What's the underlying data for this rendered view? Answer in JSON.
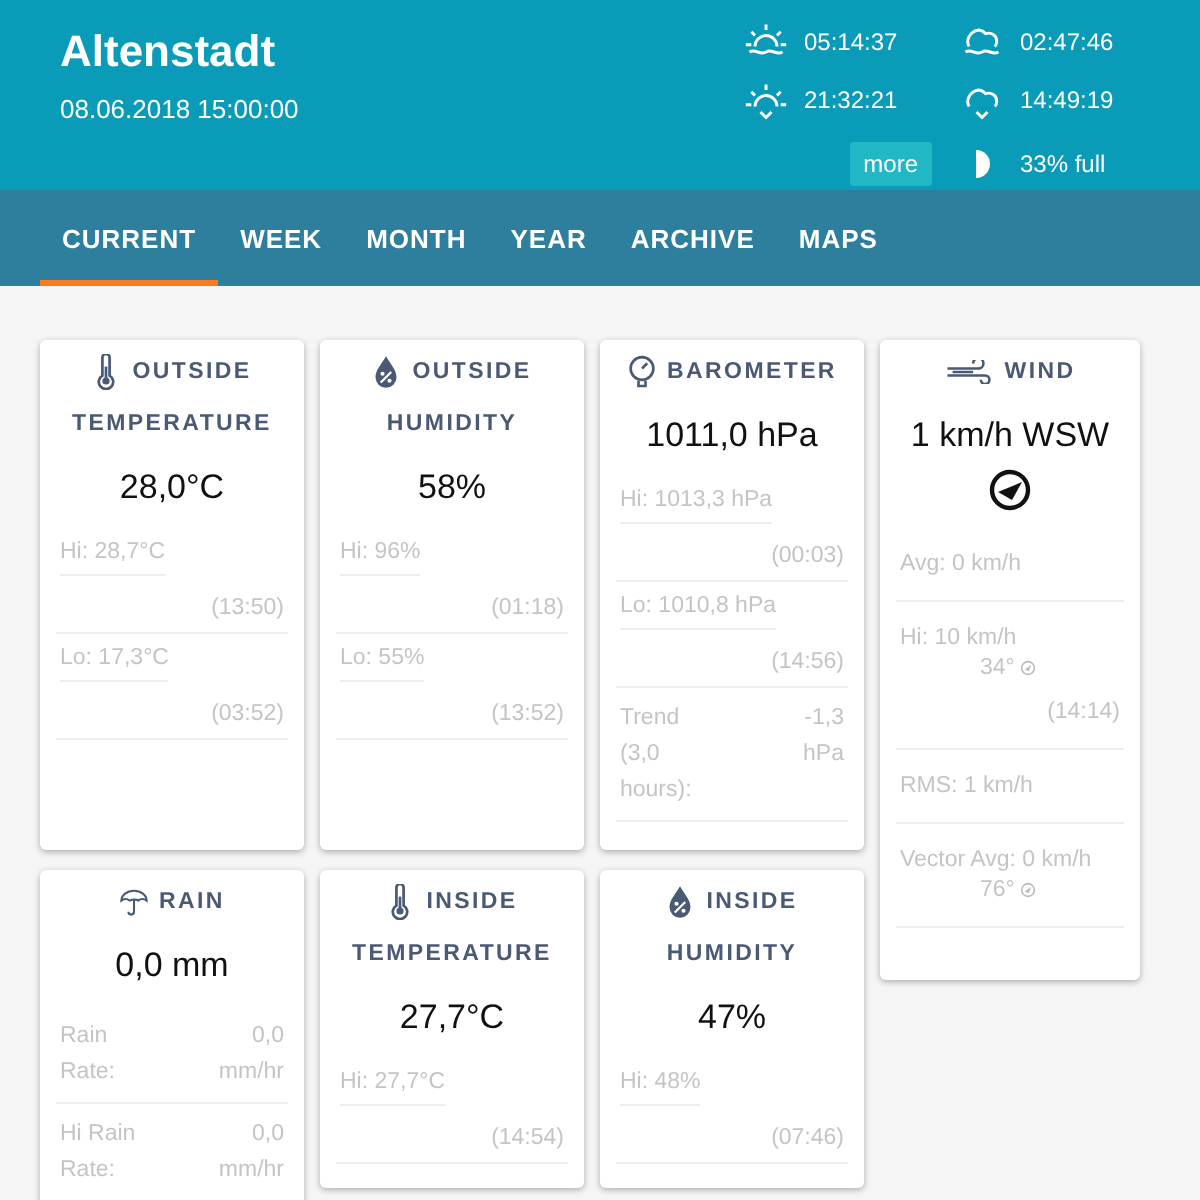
{
  "header": {
    "station": "Altenstadt",
    "datetime": "08.06.2018 15:00:00",
    "almanac": [
      {
        "kind": "sunrise",
        "time": "05:14:37"
      },
      {
        "kind": "moonrise",
        "time": "02:47:46"
      },
      {
        "kind": "sunset",
        "time": "21:32:21"
      },
      {
        "kind": "moonset",
        "time": "14:49:19"
      }
    ],
    "more_button": "more",
    "moon_phase": "33% full"
  },
  "tabs": [
    {
      "label": "CURRENT",
      "selected": true
    },
    {
      "label": "WEEK",
      "selected": false
    },
    {
      "label": "MONTH",
      "selected": false
    },
    {
      "label": "YEAR",
      "selected": false
    },
    {
      "label": "ARCHIVE",
      "selected": false
    },
    {
      "label": "MAPS",
      "selected": false
    }
  ],
  "cards": [
    {
      "kind": "thermometer",
      "title": [
        "OUTSIDE",
        "TEMPERATURE"
      ],
      "value": "28,0°C",
      "stats": [
        {
          "kind": "hilo",
          "text": "Hi: 28,7°C",
          "time": "(13:50)"
        },
        {
          "kind": "hilo",
          "text": "Lo: 17,3°C",
          "time": "(03:52)"
        }
      ]
    },
    {
      "kind": "drop",
      "title": [
        "OUTSIDE",
        "HUMIDITY"
      ],
      "value": "58%",
      "stats": [
        {
          "kind": "hilo",
          "text": "Hi: 96%",
          "time": "(01:18)"
        },
        {
          "kind": "hilo",
          "text": "Lo: 55%",
          "time": "(13:52)"
        }
      ]
    },
    {
      "kind": "gauge",
      "title": [
        "BAROMETER"
      ],
      "value": "1011,0 hPa",
      "stats": [
        {
          "kind": "hilo",
          "text": "Hi: 1013,3 hPa",
          "time": "(00:03)"
        },
        {
          "kind": "hilo",
          "text": "Lo: 1010,8 hPa",
          "time": "(14:56)"
        },
        {
          "kind": "pair",
          "text": "Trend (3,0 hours):",
          "value": "-1,3 hPa"
        }
      ]
    },
    {
      "kind": "wind",
      "title": [
        "WIND"
      ],
      "value": "1 km/h WSW",
      "stats": [
        {
          "kind": "single",
          "text": "Avg: 0 km/h"
        },
        {
          "kind": "dir",
          "text": "Hi: 10 km/h",
          "direction": "34°",
          "time": "(14:14)"
        },
        {
          "kind": "single",
          "text": "RMS: 1 km/h"
        },
        {
          "kind": "dir",
          "text": "Vector Avg: 0 km/h",
          "direction": "76°"
        }
      ]
    },
    {
      "kind": "umbrella",
      "title": [
        "RAIN"
      ],
      "value": "0,0 mm",
      "stats": [
        {
          "kind": "pair",
          "text": "Rain Rate:",
          "value": "0,0 mm/hr"
        },
        {
          "kind": "pair",
          "text": "Hi Rain Rate:",
          "value": "0,0 mm/hr"
        }
      ]
    },
    {
      "kind": "thermometer",
      "title": [
        "INSIDE",
        "TEMPERATURE"
      ],
      "value": "27,7°C",
      "stats": [
        {
          "kind": "hilo",
          "text": "Hi: 27,7°C",
          "time": "(14:54)"
        }
      ]
    },
    {
      "kind": "drop",
      "title": [
        "INSIDE",
        "HUMIDITY"
      ],
      "value": "47%",
      "stats": [
        {
          "kind": "hilo",
          "text": "Hi: 48%",
          "time": "(07:46)"
        }
      ]
    }
  ]
}
